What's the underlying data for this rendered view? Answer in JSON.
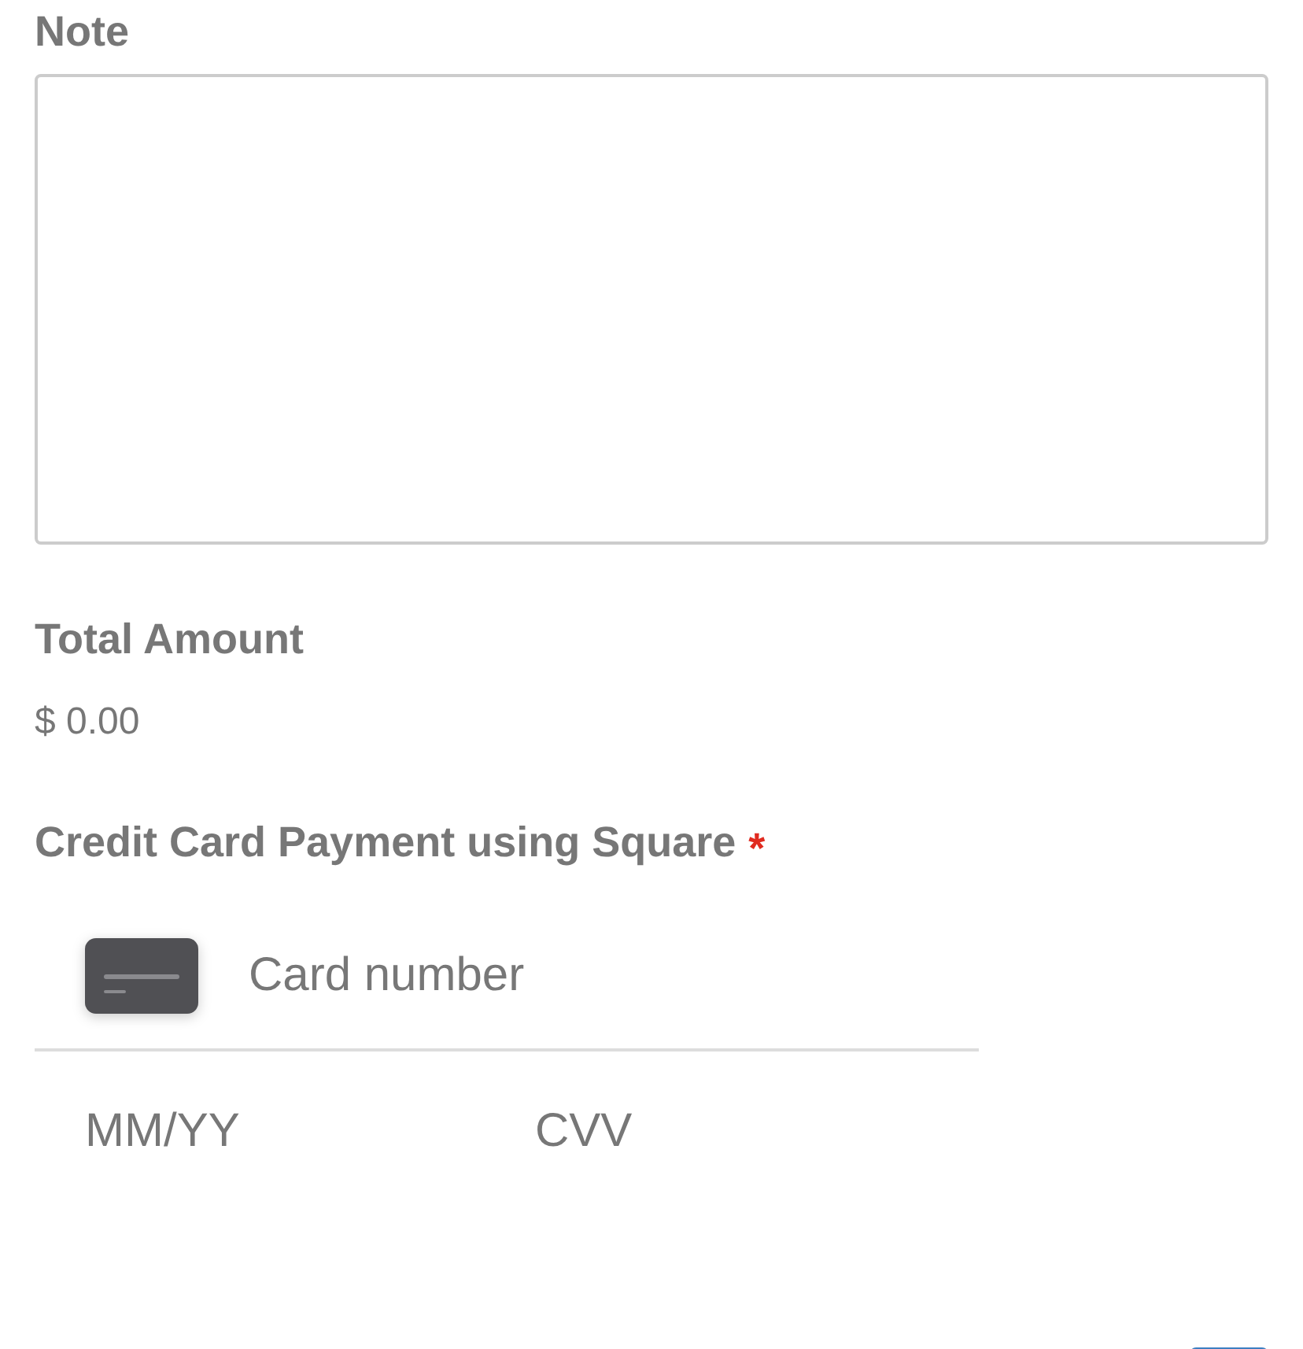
{
  "note": {
    "label": "Note"
  },
  "total": {
    "label": "Total Amount",
    "value": "$ 0.00"
  },
  "payment": {
    "label": "Credit Card Payment using Square",
    "required_mark": "*",
    "card_number": {
      "placeholder": "Card number"
    },
    "expiry": {
      "placeholder": "MM/YY"
    },
    "cvv": {
      "placeholder": "CVV"
    }
  },
  "submit": {
    "kind": "button"
  }
}
